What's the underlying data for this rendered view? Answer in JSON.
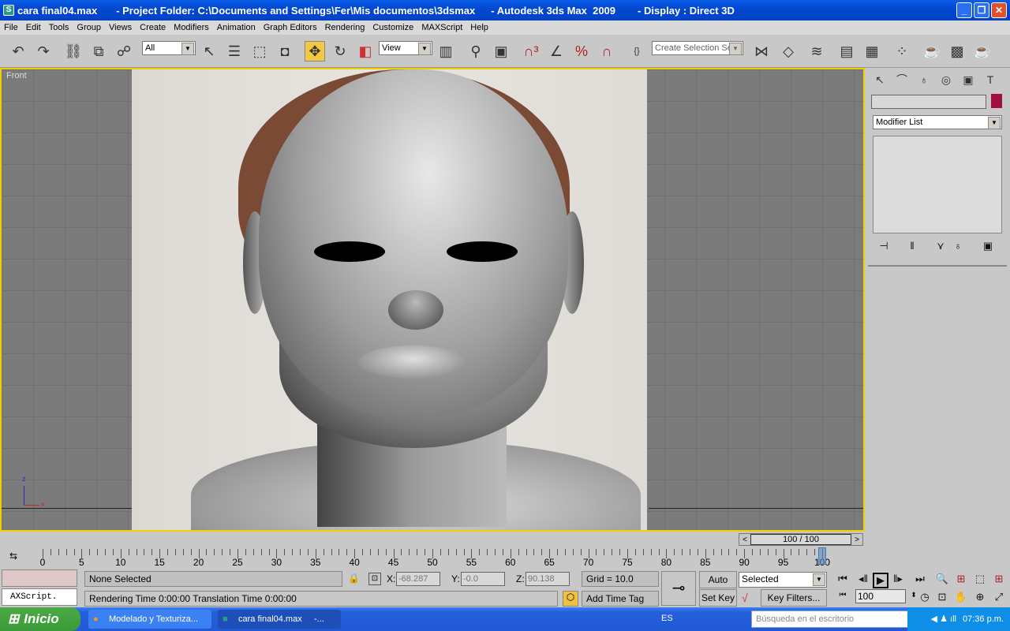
{
  "title": {
    "file": "cara final04.max",
    "project": "- Project Folder: C:\\Documents and Settings\\Fer\\Mis documentos\\3dsmax",
    "app": "- Autodesk 3ds Max  2009",
    "display": "- Display : Direct 3D"
  },
  "menu": [
    "File",
    "Edit",
    "Tools",
    "Group",
    "Views",
    "Create",
    "Modifiers",
    "Animation",
    "Graph Editors",
    "Rendering",
    "Customize",
    "MAXScript",
    "Help"
  ],
  "toolbar": {
    "filter": "All",
    "coord": "View",
    "selection_set": "Create Selection Set",
    "active_tool": "select-and-move"
  },
  "viewport": {
    "label": "Front",
    "axis_z": "z",
    "axis_x": "x",
    "border_color": "#f0d000"
  },
  "command_panel": {
    "modifier_list": "Modifier List",
    "color_swatch": "#a0103c"
  },
  "timeline": {
    "frame_display": "100 / 100",
    "ticks": [
      "0",
      "5",
      "10",
      "15",
      "20",
      "25",
      "30",
      "35",
      "40",
      "45",
      "50",
      "55",
      "60",
      "65",
      "70",
      "75",
      "80",
      "85",
      "90",
      "95",
      "100"
    ],
    "current_frame": 100,
    "max_frame": 100
  },
  "status": {
    "maxscript": "AXScript.",
    "selection": "None Selected",
    "prompt": "Rendering Time  0:00:00    Translation Time  0:00:00",
    "x_label": "X:",
    "x": "-68.287",
    "y_label": "Y:",
    "y": "-0.0",
    "z_label": "Z:",
    "z": "90.138",
    "grid": "Grid = 10.0",
    "add_time_tag": "Add Time Tag",
    "auto_key": "Auto Key",
    "set_key": "Set Key",
    "key_mode": "Selected",
    "key_filters": "Key Filters...",
    "frame": "100"
  },
  "taskbar": {
    "start": "Inicio",
    "tasks": [
      "Modelado y Texturiza...",
      "cara final04.max     -..."
    ],
    "lang": "ES",
    "search_placeholder": "Búsqueda en el escritorio",
    "clock": "07:36 p.m."
  }
}
